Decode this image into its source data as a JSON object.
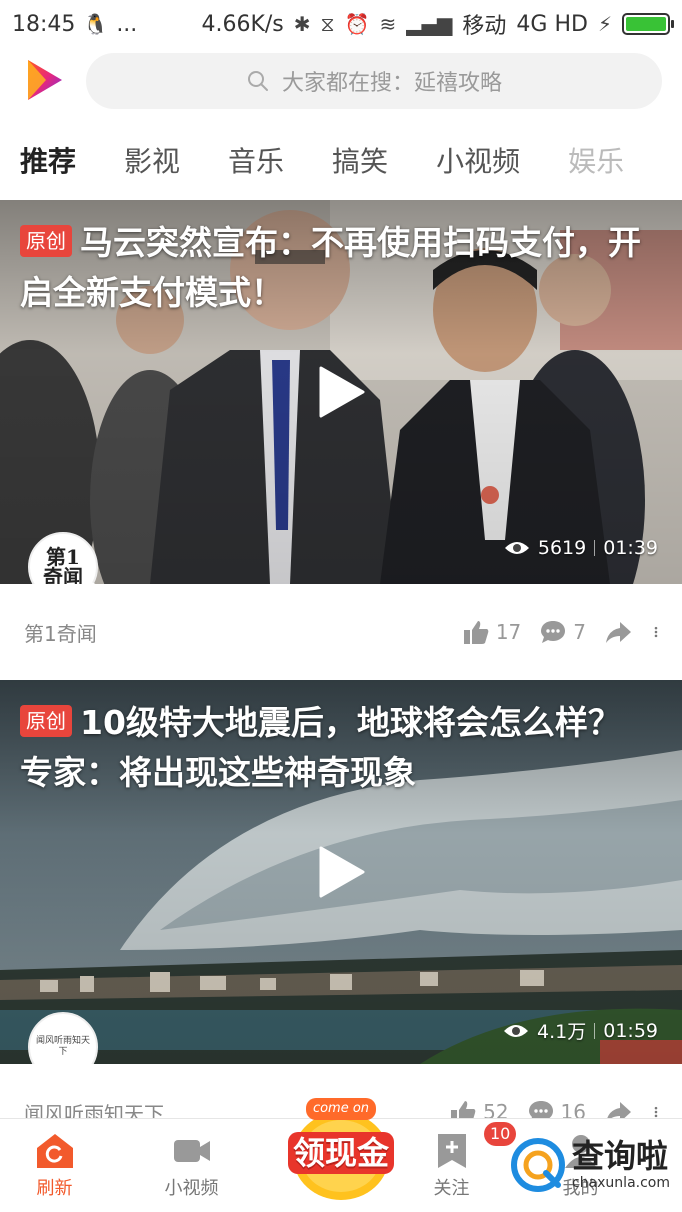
{
  "status_bar": {
    "time": "18:45",
    "dots": "...",
    "speed": "4.66K/s",
    "carrier": "移动",
    "network": "4G HD",
    "battery_level": 1.0
  },
  "search": {
    "placeholder": "大家都在搜：延禧攻略"
  },
  "tabs": [
    {
      "label": "推荐",
      "active": true
    },
    {
      "label": "影视"
    },
    {
      "label": "音乐"
    },
    {
      "label": "搞笑"
    },
    {
      "label": "小视频"
    },
    {
      "label": "娱乐"
    }
  ],
  "feed": [
    {
      "badge": "原创",
      "title": "马云突然宣布：不再使用扫码支付，开启全新支付模式！",
      "avatar_text": "第1奇闻",
      "views": "5619",
      "duration": "01:39",
      "source": "第1奇闻",
      "likes": "17",
      "comments": "7"
    },
    {
      "badge": "原创",
      "title": "10级特大地震后，地球将会怎么样？专家：将出现这些神奇现象",
      "avatar_text": "闻风听雨知天下",
      "views": "4.1万",
      "duration": "01:59",
      "source": "闻风听雨知天下",
      "likes": "52",
      "comments": "16"
    }
  ],
  "bottom_nav": {
    "refresh": "刷新",
    "short_video": "小视频",
    "promo_top": "come on",
    "promo": "领现金",
    "follow": "关注",
    "follow_badge": "10",
    "mine": "我的"
  },
  "watermark": {
    "cn": "查询啦",
    "en": "chaxunla.com"
  },
  "colors": {
    "accent": "#f25a2c",
    "badge": "#e8453c"
  }
}
